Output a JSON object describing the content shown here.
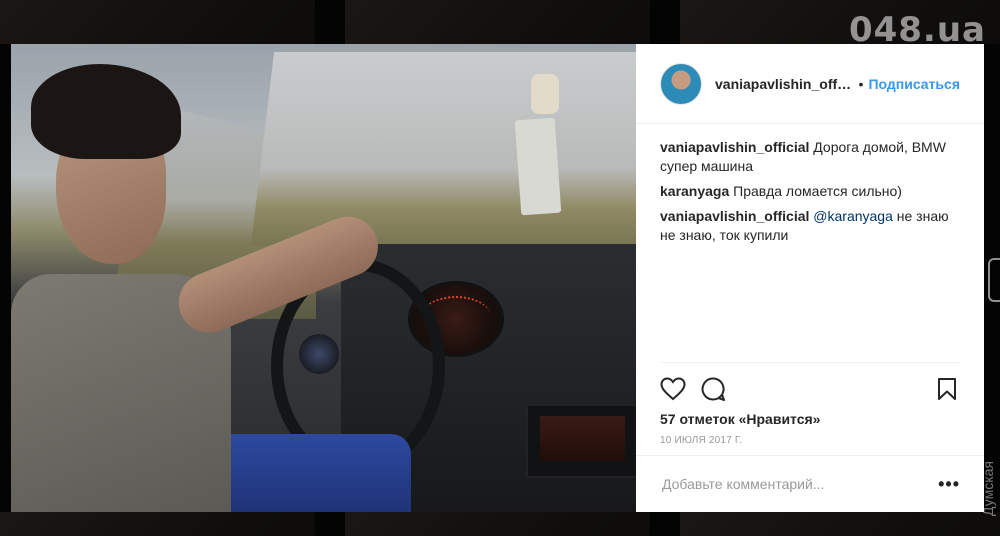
{
  "watermark": {
    "logo": "048.ua",
    "side": "Думская"
  },
  "post": {
    "username": "vaniapavlishin_offic...",
    "separator": "•",
    "follow_label": "Подписаться",
    "comments": [
      {
        "user": "vaniapavlishin_official",
        "mention": "",
        "text": " Дорога домой, BMW супер машина"
      },
      {
        "user": "karanyaga",
        "mention": "",
        "text": " Правда ломается сильно)"
      },
      {
        "user": "vaniapavlishin_official",
        "mention": "@karanyaga",
        "text": " не знаю не знаю, ток купили"
      }
    ],
    "likes": "57 отметок «Нравится»",
    "date": "10 ИЮЛЯ 2017 Г.",
    "add_comment_placeholder": "Добавьте комментарий...",
    "more_label": "•••"
  },
  "icons": {
    "like": "heart-icon",
    "comment": "comment-icon",
    "save": "bookmark-icon",
    "next": "chevron-right-icon"
  },
  "colors": {
    "link": "#3897f0",
    "text": "#262626",
    "muted": "#999999"
  }
}
